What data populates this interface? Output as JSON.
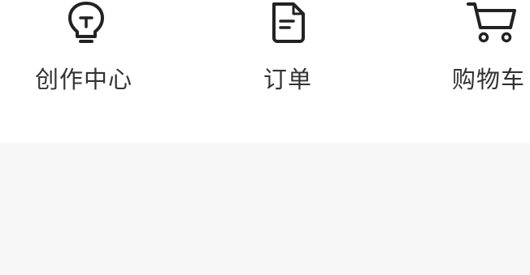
{
  "nav": {
    "items": [
      {
        "label": "创作中心",
        "icon": "lightbulb-icon"
      },
      {
        "label": "订单",
        "icon": "document-icon"
      },
      {
        "label": "购物车",
        "icon": "cart-icon"
      }
    ]
  },
  "colors": {
    "text": "#333333",
    "icon": "#222222",
    "panel_background": "#f7f7f7"
  }
}
